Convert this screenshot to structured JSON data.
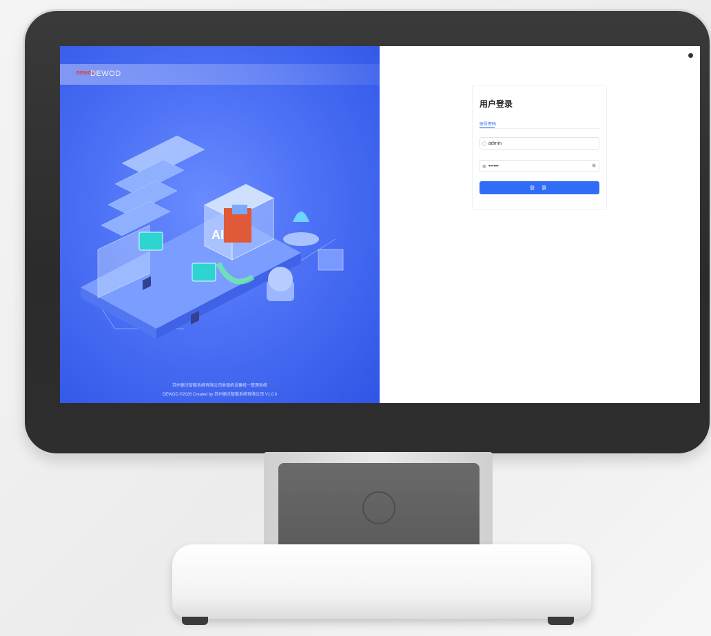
{
  "brand": {
    "logo_text": "DEWOD",
    "name": "DEWOD"
  },
  "login": {
    "title": "用户登录",
    "tab_label": "账号密码",
    "username": "admin",
    "password_mask": "••••••",
    "submit_label": "登 录"
  },
  "footer": {
    "line1": "苏州德沃智能系统有限公司收银机设备统一管理系统",
    "line2": "DEWOD ©2026 Created by 苏州德沃智能系统有限公司 V1.0.0"
  },
  "colors": {
    "accent": "#2f6df6",
    "banner": "#4c70f5",
    "brand_red": "#e23a2f"
  },
  "icons": {
    "user": "user-icon",
    "lock": "lock-icon",
    "eye": "eye-icon"
  }
}
